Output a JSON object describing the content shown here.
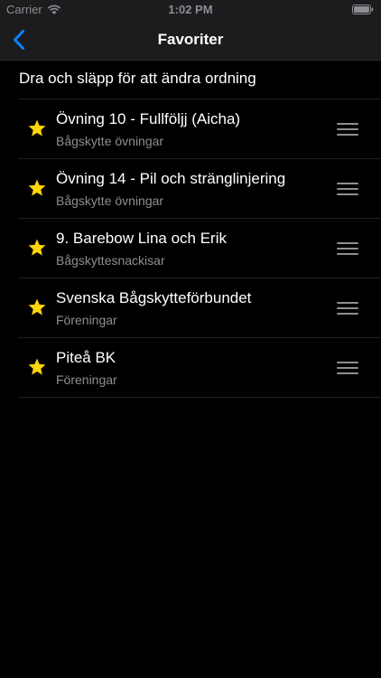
{
  "status_bar": {
    "carrier": "Carrier",
    "time": "1:02 PM",
    "icons": [
      "wifi-icon",
      "battery-icon"
    ]
  },
  "nav": {
    "title": "Favoriter",
    "back_icon": "chevron-left-icon",
    "accent_color": "#0a84ff"
  },
  "instruction": "Dra och släpp för att ändra ordning",
  "favorites": [
    {
      "title": "Övning 10 - Fullföljj (Aicha)",
      "subtitle": "Bågskytte övningar"
    },
    {
      "title": "Övning 14 - Pil och stränglinjering",
      "subtitle": "Bågskytte övningar"
    },
    {
      "title": "9. Barebow Lina och Erik",
      "subtitle": "Bågskyttesnackisar"
    },
    {
      "title": "Svenska Bågskytteförbundet",
      "subtitle": "Föreningar"
    },
    {
      "title": "Piteå BK",
      "subtitle": "Föreningar"
    }
  ],
  "colors": {
    "star": "#ffd60a",
    "background": "#000000",
    "secondary_text": "#8e8e93"
  }
}
